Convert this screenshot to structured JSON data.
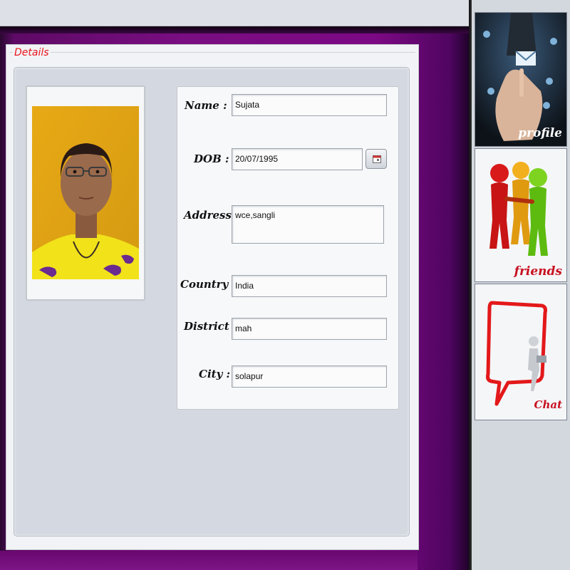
{
  "details": {
    "legend": "Details"
  },
  "form": {
    "name_label": "Name :",
    "name_value": "Sujata",
    "dob_label": "DOB :",
    "dob_value": "20/07/1995",
    "address_label": "Address :",
    "address_value": "wce,sangli",
    "country_label": "Country :",
    "country_value": "India",
    "district_label": "District :",
    "district_value": "mah",
    "city_label": "City :",
    "city_value": "solapur"
  },
  "nav": {
    "profile_label": "profile",
    "friends_label": "friends",
    "chat_label": "Chat"
  },
  "colors": {
    "accent": "#7a0d82",
    "legend": "#e8141a",
    "nav_label_dark": "#ffffff",
    "nav_label_red": "#c81020"
  },
  "icons": {
    "profile": "touch-envelope-icon",
    "friends": "people-group-icon",
    "chat": "speech-bubble-icon",
    "calendar": "calendar-icon"
  }
}
